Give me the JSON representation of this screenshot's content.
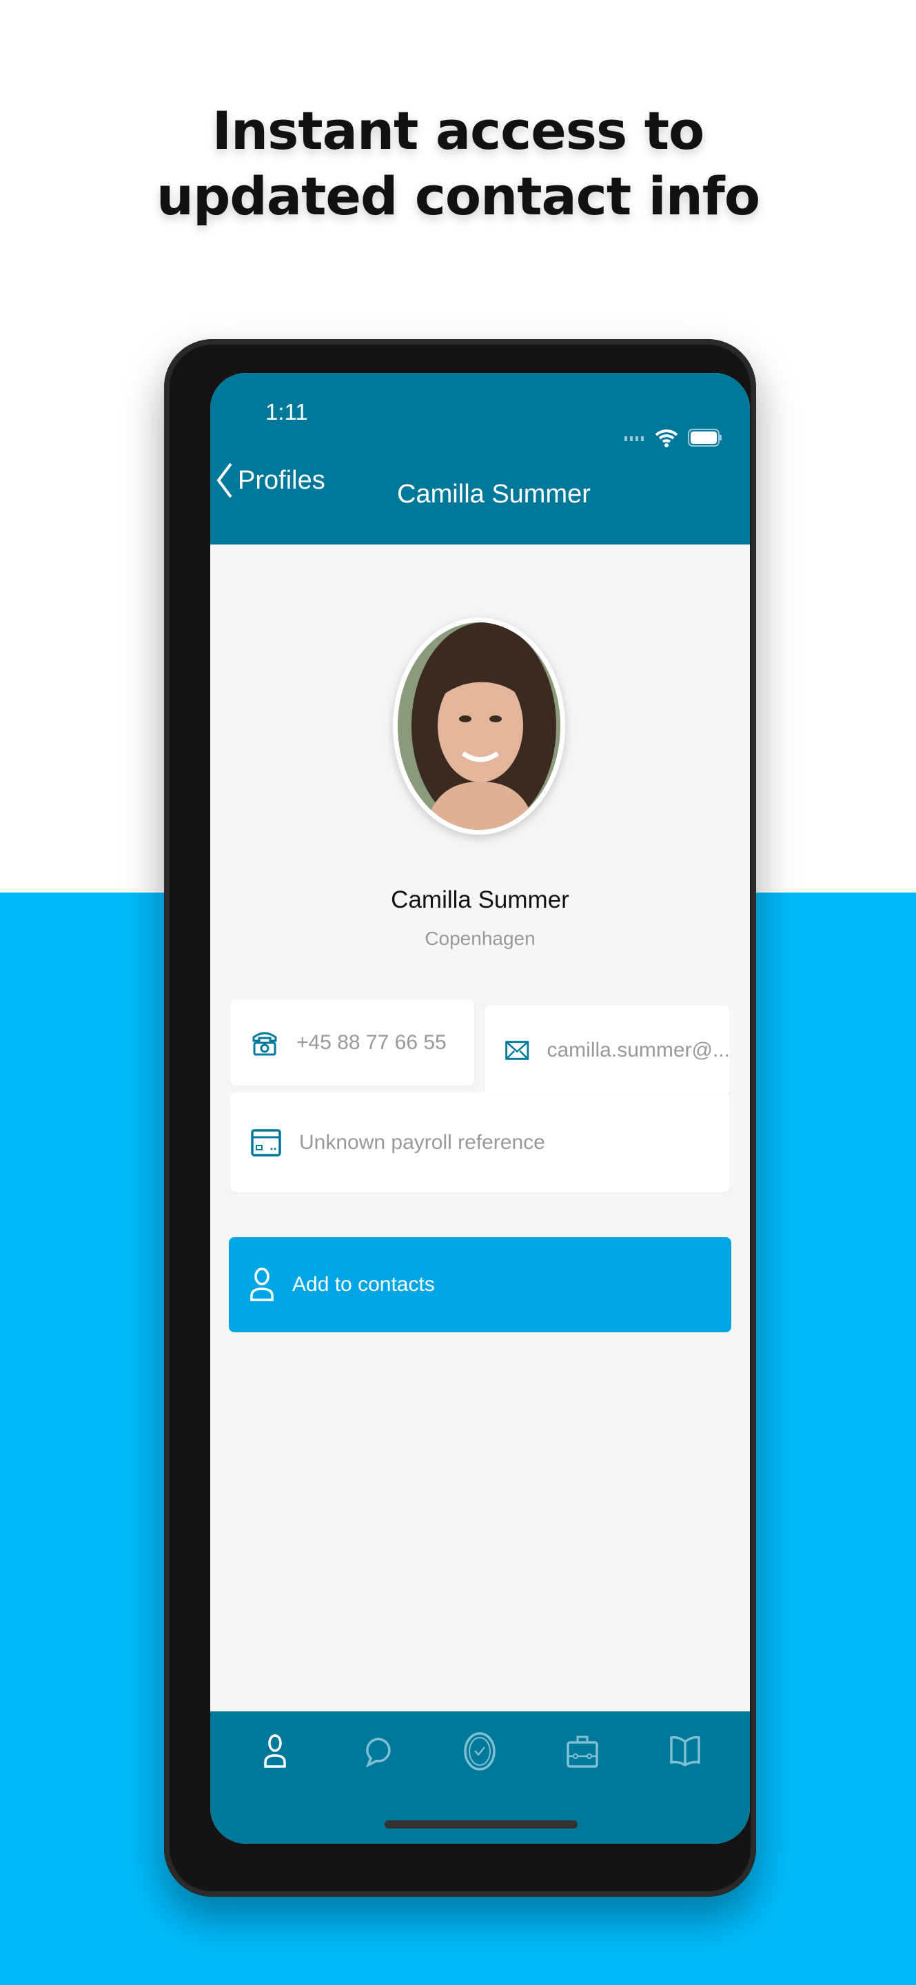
{
  "headline": {
    "line1": "Instant access to",
    "line2": "updated contact info"
  },
  "colors": {
    "header": "#00789A",
    "accent_button": "#00A6E4",
    "background_blue": "#00B9F8"
  },
  "status_bar": {
    "time": "1:11",
    "icons": [
      "signal-icon",
      "wifi-icon",
      "battery-icon"
    ]
  },
  "nav": {
    "back_label": "Profiles",
    "title": "Camilla Summer"
  },
  "profile": {
    "name": "Camilla Summer",
    "city": "Copenhagen"
  },
  "contact": {
    "phone": "+45 88 77 66 55",
    "email": "camilla.summer@...",
    "payroll": "Unknown payroll reference"
  },
  "actions": {
    "add_contacts": "Add to contacts"
  },
  "tabs": [
    {
      "icon": "person-icon",
      "active": true
    },
    {
      "icon": "chat-bubble-icon"
    },
    {
      "icon": "clock-check-icon"
    },
    {
      "icon": "briefcase-icon"
    },
    {
      "icon": "book-icon"
    }
  ]
}
